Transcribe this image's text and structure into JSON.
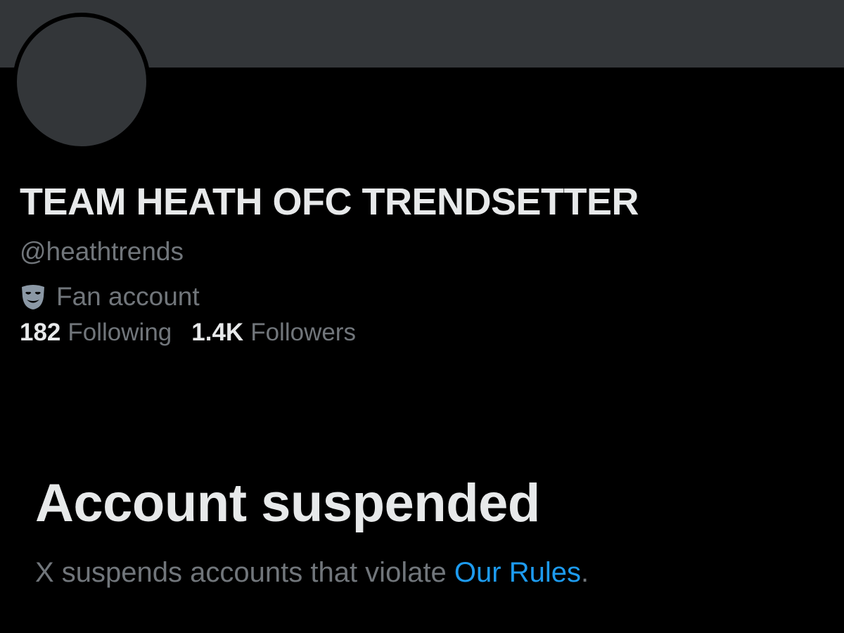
{
  "profile": {
    "display_name": "TEAM HEATH OFC TRENDSETTER",
    "handle": "@heathtrends",
    "category": {
      "icon": "performing-arts-icon",
      "label": "Fan account"
    },
    "stats": {
      "following_count": "182",
      "following_label": "Following",
      "followers_count": "1.4K",
      "followers_label": "Followers"
    }
  },
  "suspension": {
    "title": "Account suspended",
    "message_prefix": "X suspends accounts that violate ",
    "rules_link": "Our Rules",
    "message_suffix": "."
  },
  "colors": {
    "background": "#000000",
    "banner": "#333639",
    "primary_text": "#e7e9ea",
    "secondary_text": "#71767b",
    "link": "#1d9bf0"
  }
}
